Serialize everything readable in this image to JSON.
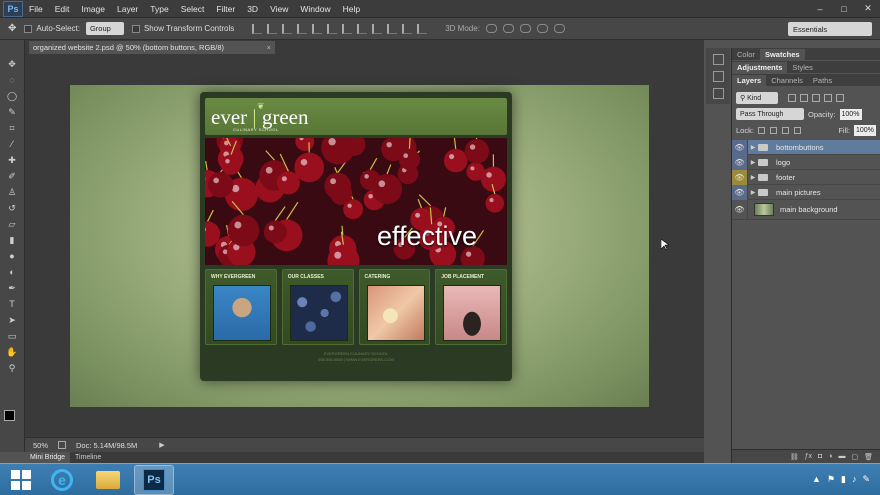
{
  "app": {
    "logo": "Ps",
    "menu": [
      "File",
      "Edit",
      "Image",
      "Layer",
      "Type",
      "Select",
      "Filter",
      "3D",
      "View",
      "Window",
      "Help"
    ],
    "window_controls": [
      "–",
      "□",
      "✕"
    ]
  },
  "options_bar": {
    "auto_select_label": "Auto-Select:",
    "auto_select_value": "Group",
    "transform_label": "Show Transform Controls",
    "mode_label": "3D Mode:",
    "workspace": "Essentials"
  },
  "document": {
    "tab_title": "organized website 2.psd @ 50% (bottom buttons, RGB/8)",
    "tab_close": "×"
  },
  "site": {
    "brand_left": "ever",
    "brand_right": "green",
    "brand_sub": "CULINARY SCHOOL",
    "hero_text": "effective",
    "cards": [
      {
        "title": "WHY EVERGREEN"
      },
      {
        "title": "OUR CLASSES"
      },
      {
        "title": "CATERING"
      },
      {
        "title": "JOB PLACEMENT"
      }
    ],
    "footer_line1": "EVERGREEN CULINARY SCHOOL",
    "footer_line2": "555.555.5555 | WWW.EVERGREEN.COM"
  },
  "status": {
    "zoom": "50%",
    "doc_size": "Doc: 5.14M/98.5M",
    "arrow": "▶"
  },
  "bottom_tabs": [
    "Mini Bridge",
    "Timeline"
  ],
  "panels": {
    "top_tabs": [
      "Color",
      "Swatches"
    ],
    "mid_tabs": [
      "Adjustments",
      "Styles"
    ],
    "layer_tabs": [
      "Layers",
      "Channels",
      "Paths"
    ],
    "kind_label": "Kind",
    "blend_mode": "Pass Through",
    "opacity_label": "Opacity:",
    "opacity_value": "100%",
    "lock_label": "Lock:",
    "fill_label": "Fill:",
    "fill_value": "100%"
  },
  "layers": [
    {
      "name": "bottombuttons",
      "type": "group",
      "selected": true
    },
    {
      "name": "logo",
      "type": "group",
      "selected": false
    },
    {
      "name": "footer",
      "type": "group",
      "selected": false
    },
    {
      "name": "main pictures",
      "type": "group",
      "selected": false
    },
    {
      "name": "main background",
      "type": "layer",
      "selected": false
    }
  ],
  "colors": {
    "site_header": "#5f7e3c",
    "selected_layer": "#5f7c9c",
    "taskbar": "#3a78ad"
  }
}
